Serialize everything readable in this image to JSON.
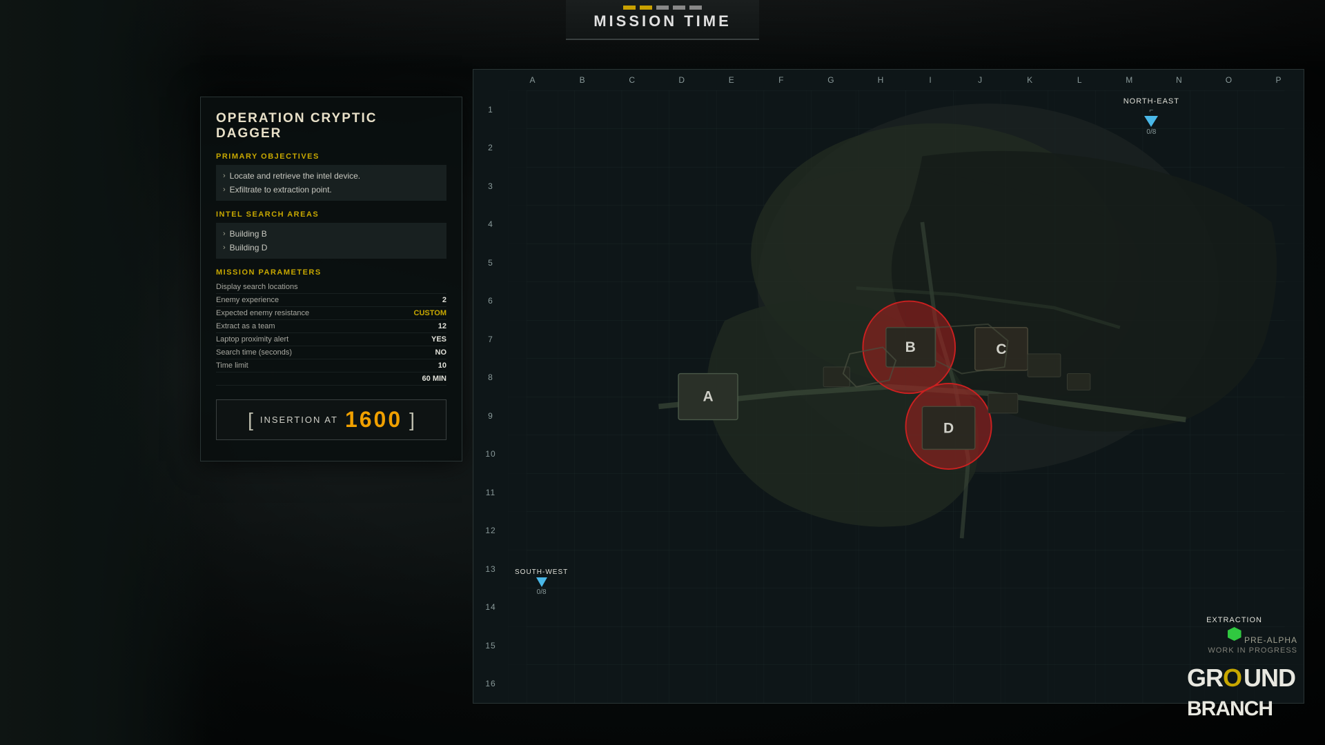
{
  "header": {
    "mission_time_label": "MISSION TIME",
    "time_segments": 5
  },
  "briefing": {
    "operation_title": "OPERATION CRYPTIC DAGGER",
    "sections": {
      "primary_objectives": {
        "header": "PRIMARY OBJECTIVES",
        "items": [
          "Locate and retrieve the intel device.",
          "Exfiltrate to extraction point."
        ]
      },
      "intel_search_areas": {
        "header": "INTEL SEARCH AREAS",
        "items": [
          "Building B",
          "Building D"
        ]
      },
      "mission_parameters": {
        "header": "MISSION PARAMETERS",
        "params": [
          {
            "label": "Display search locations",
            "value": ""
          },
          {
            "label": "Enemy experience",
            "value": "2"
          },
          {
            "label": "Expected enemy resistance",
            "value": "CUSTOM"
          },
          {
            "label": "Extract as a team",
            "value": "12"
          },
          {
            "label": "Laptop proximity alert",
            "value": "YES"
          },
          {
            "label": "Search time (seconds)",
            "value": "NO"
          },
          {
            "label": "Time limit",
            "value": "10"
          },
          {
            "label": "",
            "value": "60 MIN"
          }
        ]
      }
    },
    "insertion": {
      "label": "INSERTION AT",
      "time": "1600"
    }
  },
  "map": {
    "col_headers": [
      "A",
      "B",
      "C",
      "D",
      "E",
      "F",
      "G",
      "H",
      "I",
      "J",
      "K",
      "L",
      "M",
      "N",
      "O",
      "P"
    ],
    "row_headers": [
      "1",
      "2",
      "3",
      "4",
      "5",
      "6",
      "7",
      "8",
      "9",
      "10",
      "11",
      "12",
      "13",
      "14",
      "15",
      "16"
    ],
    "ne_marker": {
      "label": "NORTH-EAST",
      "count": "0/8"
    },
    "sw_marker": {
      "label": "SOUTH-WEST",
      "count": "0/8"
    },
    "extraction_marker": {
      "label": "EXTRACTION"
    },
    "map_labels": [
      "A",
      "B",
      "C",
      "D"
    ]
  },
  "watermark": {
    "pre_alpha": "PRE-ALPHA",
    "wip": "WORK IN PROGRESS",
    "logo_ground": "GR",
    "logo_slash": "O",
    "logo_branch": "UND BRANCH"
  }
}
